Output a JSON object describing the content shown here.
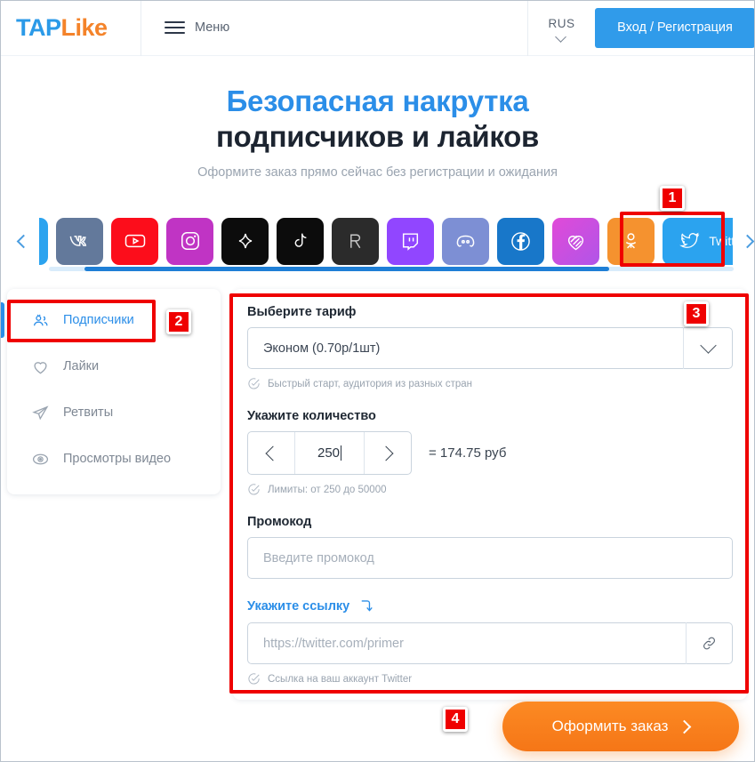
{
  "header": {
    "logo_tap": "TAP",
    "logo_like": "Like",
    "menu_label": "Меню",
    "language": "RUS",
    "login_label": "Вход / Регистрация"
  },
  "hero": {
    "title_line1": "Безопасная накрутка",
    "title_line2": "подписчиков и лайков",
    "subtitle": "Оформите заказ прямо сейчас без регистрации и ожидания"
  },
  "carousel": {
    "tiles": [
      {
        "name": "vk",
        "label": "",
        "color": "#63799b"
      },
      {
        "name": "youtube",
        "label": "",
        "color": "#fc0d1b"
      },
      {
        "name": "instagram",
        "label": "",
        "color": "#c034c4"
      },
      {
        "name": "telegram-star",
        "label": "",
        "color": "#0c0c0c"
      },
      {
        "name": "tiktok",
        "label": "",
        "color": "#0c0c0c"
      },
      {
        "name": "rutube",
        "label": "",
        "color": "#2b2b2b"
      },
      {
        "name": "twitch",
        "label": "",
        "color": "#9146ff"
      },
      {
        "name": "discord",
        "label": "",
        "color": "#7d8fd4"
      },
      {
        "name": "facebook",
        "label": "",
        "color": "#1877c9"
      },
      {
        "name": "likee",
        "label": "",
        "color": "#d14ad8"
      },
      {
        "name": "odnoklassniki",
        "label": "",
        "color": "#f5922f"
      },
      {
        "name": "twitter",
        "label": "Twitter",
        "color": "#2ba3ef"
      }
    ],
    "selected": "twitter"
  },
  "sidebar": {
    "items": [
      {
        "label": "Подписчики",
        "icon": "users-icon",
        "active": true
      },
      {
        "label": "Лайки",
        "icon": "heart-icon",
        "active": false
      },
      {
        "label": "Ретвиты",
        "icon": "send-icon",
        "active": false
      },
      {
        "label": "Просмотры видео",
        "icon": "eye-icon",
        "active": false
      }
    ]
  },
  "form": {
    "tariff_label": "Выберите тариф",
    "tariff_value": "Эконом (0.70р/1шт)",
    "tariff_hint": "Быстрый старт, аудитория из разных стран",
    "quantity_label": "Укажите количество",
    "quantity_value": "250",
    "price_text": "= 174.75 руб",
    "quantity_hint": "Лимиты: от 250 до 50000",
    "promo_label": "Промокод",
    "promo_placeholder": "Введите промокод",
    "link_label": "Укажите ссылку",
    "link_placeholder": "https://twitter.com/primer",
    "link_hint": "Ссылка на ваш аккаунт Twitter"
  },
  "order_button": {
    "label": "Оформить заказ"
  },
  "annotations": {
    "marker1": "1",
    "marker2": "2",
    "marker3": "3",
    "marker4": "4"
  },
  "colors": {
    "brand_blue": "#2b8ee8",
    "brand_orange": "#f4832a",
    "annotation_red": "#ef0000"
  }
}
